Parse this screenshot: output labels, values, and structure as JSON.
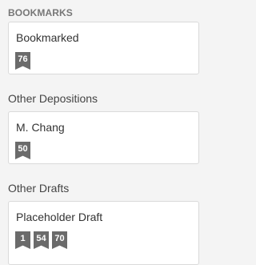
{
  "sections": [
    {
      "header": "BOOKMARKS",
      "cards": [
        {
          "title": "Bookmarked",
          "badges": [
            "76"
          ]
        }
      ]
    },
    {
      "header": "Other Depositions",
      "cards": [
        {
          "title": "M. Chang",
          "badges": [
            "50"
          ]
        }
      ]
    },
    {
      "header": "Other Drafts",
      "cards": [
        {
          "title": "Placeholder Draft",
          "badges": [
            "1",
            "54",
            "70"
          ]
        }
      ]
    }
  ],
  "colors": {
    "background": "#f4f4f4",
    "card": "#ffffff",
    "card_border": "#dadada",
    "badge": "#6b6b6b",
    "badge_text": "#ffffff"
  },
  "icons": {
    "badge": "bookmark-ribbon-icon"
  }
}
